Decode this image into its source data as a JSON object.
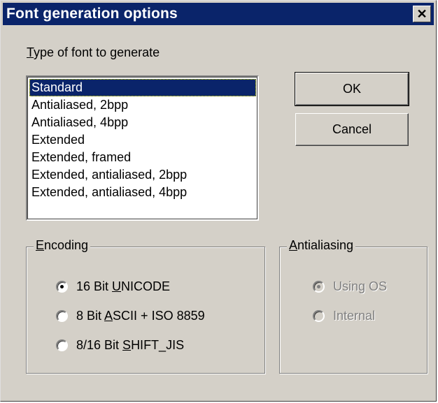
{
  "window": {
    "title": "Font generation options",
    "close_glyph": "✕"
  },
  "font_type": {
    "label_access": "T",
    "label_rest": "ype of font to generate",
    "items": [
      "Standard",
      "Antialiased, 2bpp",
      "Antialiased, 4bpp",
      "Extended",
      "Extended, framed",
      "Extended, antialiased, 2bpp",
      "Extended, antialiased, 4bpp"
    ],
    "selected_index": 0
  },
  "buttons": {
    "ok": "OK",
    "cancel": "Cancel"
  },
  "encoding": {
    "legend_access": "E",
    "legend_rest": "ncoding",
    "options": [
      {
        "pre": "16 Bit ",
        "access": "U",
        "post": "NICODE",
        "checked": true
      },
      {
        "pre": "8 Bit ",
        "access": "A",
        "post": "SCII + ISO 8859",
        "checked": false
      },
      {
        "pre": "8/16 Bit ",
        "access": "S",
        "post": "HIFT_JIS",
        "checked": false
      }
    ]
  },
  "antialiasing": {
    "legend_access": "A",
    "legend_rest": "ntialiasing",
    "enabled": false,
    "options": [
      {
        "label": "Using OS",
        "checked": true
      },
      {
        "label": "Internal",
        "checked": false
      }
    ]
  },
  "colors": {
    "titlebar": "#0a246a",
    "face": "#d4d0c8",
    "selection": "#0a246a"
  }
}
